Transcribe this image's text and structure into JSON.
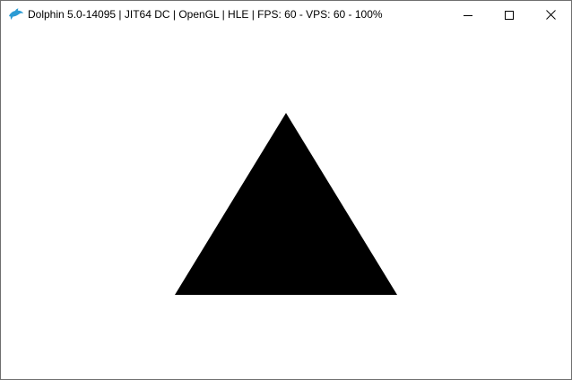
{
  "window": {
    "title": "Dolphin 5.0-14095 | JIT64 DC | OpenGL | HLE | FPS: 60 - VPS: 60 - 100%",
    "app_icon": "dolphin-icon",
    "accent_color": "#2b9bd4",
    "caption_buttons": {
      "minimize": "minimize-icon",
      "maximize": "maximize-icon",
      "close": "close-icon"
    }
  },
  "render": {
    "background_color": "#ffffff",
    "shape": "triangle",
    "shape_color": "#000000"
  }
}
